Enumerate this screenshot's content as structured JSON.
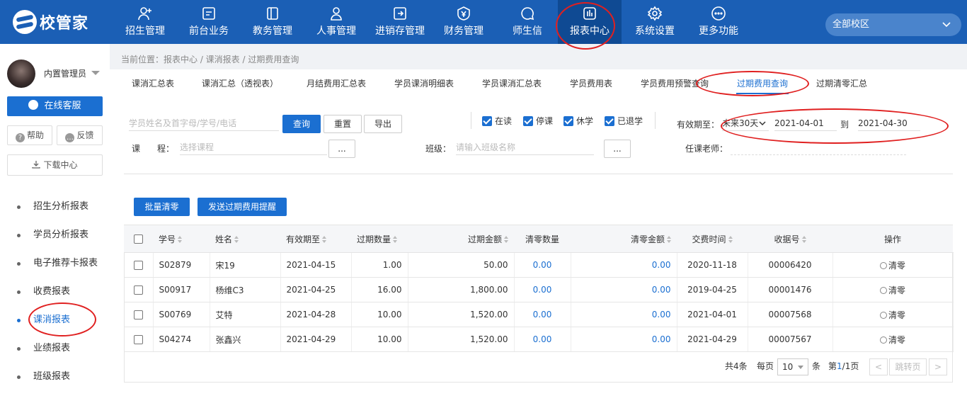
{
  "app": {
    "logo_text": "校管家"
  },
  "nav": [
    {
      "label": "招生管理",
      "icon": "person-add-icon"
    },
    {
      "label": "前台业务",
      "icon": "screen-icon"
    },
    {
      "label": "教务管理",
      "icon": "book-icon"
    },
    {
      "label": "人事管理",
      "icon": "person-icon"
    },
    {
      "label": "进销存管理",
      "icon": "arrow-box-icon"
    },
    {
      "label": "财务管理",
      "icon": "yen-shield-icon"
    },
    {
      "label": "师生信",
      "icon": "chat-bubble-icon"
    },
    {
      "label": "报表中心",
      "icon": "bar-chart-icon",
      "active": true
    },
    {
      "label": "系统设置",
      "icon": "gear-icon"
    },
    {
      "label": "更多功能",
      "icon": "more-icon"
    }
  ],
  "campus": {
    "label": "全部校区"
  },
  "user": {
    "name": "内置管理员"
  },
  "sidebar": {
    "service_label": "在线客服",
    "help_label": "帮助",
    "feedback_label": "反馈",
    "download_label": "下载中心",
    "menu": [
      "招生分析报表",
      "学员分析报表",
      "电子推荐卡报表",
      "收费报表",
      "课消报表",
      "业绩报表",
      "班级报表"
    ],
    "active_index": 4
  },
  "breadcrumb": "当前位置：报表中心 / 课消报表 / 过期费用查询",
  "tabs": [
    "课消汇总表",
    "课消汇总（透视表）",
    "月结费用汇总表",
    "学员课消明细表",
    "学员课消汇总表",
    "学员费用表",
    "学员费用预警查询",
    "过期费用查询",
    "过期清零汇总"
  ],
  "active_tab": 7,
  "filters": {
    "search_placeholder": "学员姓名及首字母/学号/电话",
    "query_label": "查询",
    "reset_label": "重置",
    "export_label": "导出",
    "status_checks": [
      "在读",
      "停课",
      "休学",
      "已退学"
    ],
    "valid_until_label": "有效期至：",
    "period_select": "未来30天",
    "date_from": "2021-04-01",
    "date_to_label": "到",
    "date_to": "2021-04-30",
    "course_label": "课　　程：",
    "course_placeholder": "选择课程",
    "class_label": "班级：",
    "class_placeholder": "请输入班级名称",
    "teacher_label": "任课老师：",
    "ellipsis": "..."
  },
  "actions": {
    "batch_clear": "批量清零",
    "send_reminder": "发送过期费用提醒"
  },
  "table": {
    "headers": [
      "学号",
      "姓名",
      "有效期至",
      "过期数量",
      "过期金额",
      "清零数量",
      "清零金额",
      "交费时间",
      "收据号",
      "操作"
    ],
    "rows": [
      [
        "S02879",
        "宋19",
        "2021-04-15",
        "1.00",
        "50.00",
        "0.00",
        "0.00",
        "2020-11-18",
        "00006420",
        "清零"
      ],
      [
        "S00917",
        "杨维C3",
        "2021-04-25",
        "16.00",
        "1,800.00",
        "0.00",
        "0.00",
        "2019-04-25",
        "00001476",
        "清零"
      ],
      [
        "S00769",
        "艾特",
        "2021-04-28",
        "10.00",
        "1,520.00",
        "0.00",
        "0.00",
        "2021-04-01",
        "00007568",
        "清零"
      ],
      [
        "S04274",
        "张鑫兴",
        "2021-04-29",
        "10.00",
        "1,520.00",
        "0.00",
        "0.00",
        "2021-04-29",
        "00007567",
        "清零"
      ]
    ]
  },
  "pager": {
    "total": "共4条",
    "per_page_label": "每页",
    "per_page": "10",
    "unit": "条",
    "page_prefix": "第",
    "page_current": "1",
    "page_suffix": "/1页",
    "prev": "<",
    "jump": "跳转页",
    "next": ">"
  },
  "colors": {
    "brand": "#1b5fb5",
    "accent": "#1b6fd1",
    "annotation": "#e02020"
  }
}
